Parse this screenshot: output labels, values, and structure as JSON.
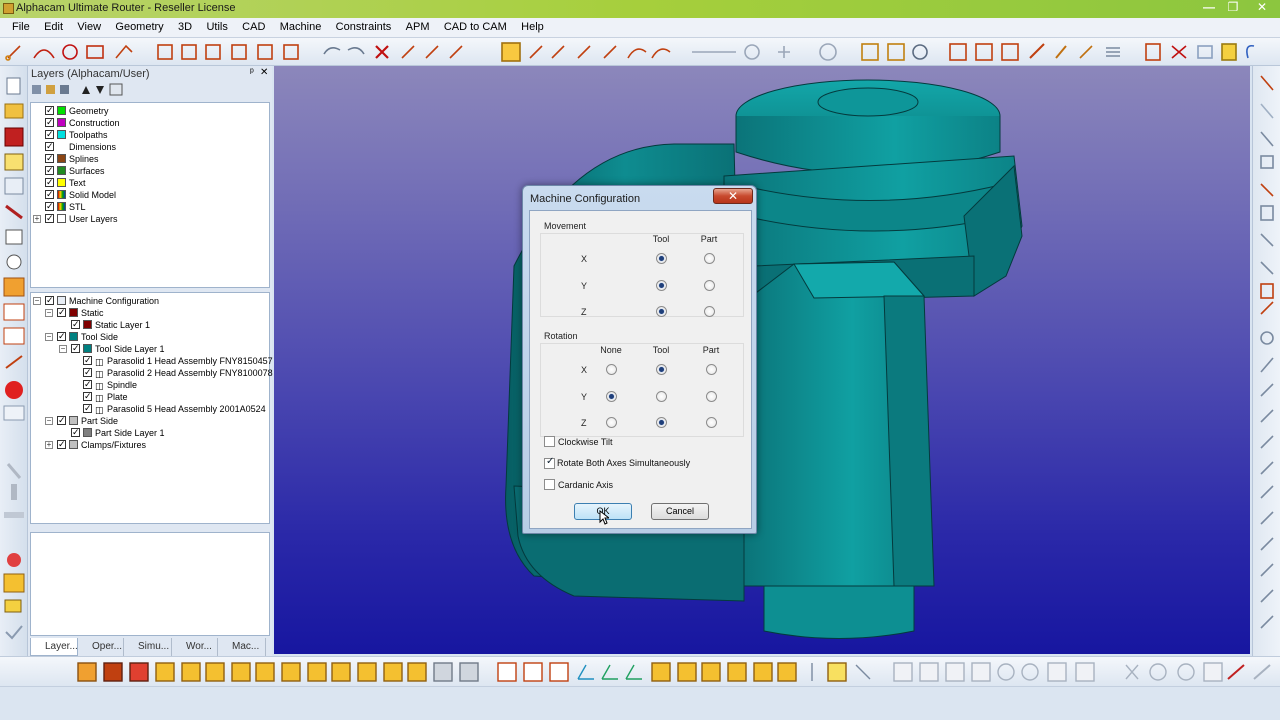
{
  "window": {
    "title": "Alphacam Ultimate Router - Reseller License",
    "controls": [
      "—",
      "❐",
      "✕"
    ]
  },
  "menu": [
    "File",
    "Edit",
    "View",
    "Geometry",
    "3D",
    "Utils",
    "CAD",
    "Machine",
    "Constraints",
    "APM",
    "CAD to CAM",
    "Help"
  ],
  "layers_panel": {
    "title": "Layers (Alphacam/User)",
    "pin": "ᵖ",
    "close": "✕",
    "layers": [
      {
        "label": "Geometry",
        "color": "#00e000"
      },
      {
        "label": "Construction",
        "color": "#c000c0"
      },
      {
        "label": "Toolpaths",
        "color": "#00e0e0"
      },
      {
        "label": "Dimensions",
        "color": "#ffffff"
      },
      {
        "label": "Splines",
        "color": "#8b4513"
      },
      {
        "label": "Surfaces",
        "color": "#228b22"
      },
      {
        "label": "Text",
        "color": "#ffff00"
      },
      {
        "label": "Solid Model",
        "color": "#c00000"
      },
      {
        "label": "STL",
        "color": "#1040c0"
      },
      {
        "label": "User Layers",
        "color": "#ffffff"
      }
    ],
    "machine_tree": [
      {
        "label": "Machine Configuration",
        "level": 0,
        "color": "#ffffff"
      },
      {
        "label": "Static",
        "level": 1,
        "color": "#800000"
      },
      {
        "label": "Static Layer 1",
        "level": 2,
        "color": "#800000"
      },
      {
        "label": "Tool Side",
        "level": 1,
        "color": "#008080"
      },
      {
        "label": "Tool Side Layer 1",
        "level": 2,
        "color": "#008080"
      },
      {
        "label": "Parasolid 1 Head Assembly FNY8150457",
        "level": 3,
        "color": ""
      },
      {
        "label": "Parasolid 2 Head Assembly FNY8100078",
        "level": 3,
        "color": ""
      },
      {
        "label": "Spindle",
        "level": 3,
        "color": ""
      },
      {
        "label": "Plate",
        "level": 3,
        "color": ""
      },
      {
        "label": "Parasolid 5 Head Assembly 2001A0524",
        "level": 3,
        "color": ""
      },
      {
        "label": "Part Side",
        "level": 1,
        "color": "#c0c0c0"
      },
      {
        "label": "Part Side Layer 1",
        "level": 2,
        "color": "#808080"
      },
      {
        "label": "Clamps/Fixtures",
        "level": 1,
        "color": "#c0c0c0"
      }
    ],
    "tabs": [
      "Layer...",
      "Oper...",
      "Simu...",
      "Wor...",
      "Mac..."
    ]
  },
  "dialog": {
    "title": "Machine Configuration",
    "close": "✕",
    "movement": {
      "label": "Movement",
      "columns": [
        "Tool",
        "Part"
      ],
      "rows": [
        {
          "axis": "X",
          "selected": "Tool"
        },
        {
          "axis": "Y",
          "selected": "Tool"
        },
        {
          "axis": "Z",
          "selected": "Tool"
        }
      ]
    },
    "rotation": {
      "label": "Rotation",
      "columns": [
        "None",
        "Tool",
        "Part"
      ],
      "rows": [
        {
          "axis": "X",
          "selected": "Tool"
        },
        {
          "axis": "Y",
          "selected": "None"
        },
        {
          "axis": "Z",
          "selected": "Tool"
        }
      ]
    },
    "checkboxes": [
      {
        "label": "Clockwise Tilt",
        "checked": false
      },
      {
        "label": "Rotate Both Axes Simultaneously",
        "checked": true
      },
      {
        "label": "Cardanic Axis",
        "checked": false
      }
    ],
    "ok_label": "OK",
    "cancel_label": "Cancel"
  },
  "colors": {
    "model": "#0d8a8a",
    "viewport_top": "#8c87bb",
    "viewport_bottom": "#1716a0"
  }
}
